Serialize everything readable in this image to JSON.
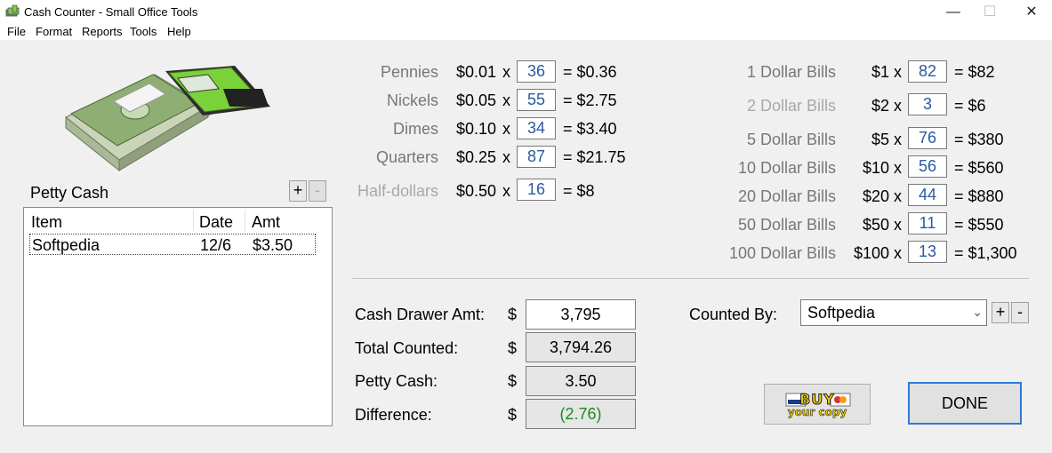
{
  "window": {
    "title": "Cash Counter - Small Office Tools",
    "min": "—",
    "max": "☐",
    "close": "✕"
  },
  "menu": [
    "File",
    "Format",
    "Reports",
    "Tools",
    "Help"
  ],
  "coins": [
    {
      "label": "Pennies",
      "rate": "$0.01",
      "x": "x",
      "qty": "36",
      "total": "= $0.36"
    },
    {
      "label": "Nickels",
      "rate": "$0.05",
      "x": "x",
      "qty": "55",
      "total": "= $2.75"
    },
    {
      "label": "Dimes",
      "rate": "$0.10",
      "x": "x",
      "qty": "34",
      "total": "= $3.40"
    },
    {
      "label": "Quarters",
      "rate": "$0.25",
      "x": "x",
      "qty": "87",
      "total": "= $21.75"
    },
    {
      "label": "Half-dollars",
      "rate": "$0.50",
      "x": "x",
      "qty": "16",
      "total": "= $8"
    }
  ],
  "bills": [
    {
      "label": "1 Dollar Bills",
      "rate": "$1",
      "x": "x",
      "qty": "82",
      "total": "= $82"
    },
    {
      "label": "2 Dollar Bills",
      "rate": "$2",
      "x": "x",
      "qty": "3",
      "total": "= $6"
    },
    {
      "label": "5 Dollar Bills",
      "rate": "$5",
      "x": "x",
      "qty": "76",
      "total": "= $380"
    },
    {
      "label": "10 Dollar Bills",
      "rate": "$10",
      "x": "x",
      "qty": "56",
      "total": "= $560"
    },
    {
      "label": "20 Dollar Bills",
      "rate": "$20",
      "x": "x",
      "qty": "44",
      "total": "= $880"
    },
    {
      "label": "50 Dollar Bills",
      "rate": "$50",
      "x": "x",
      "qty": "11",
      "total": "= $550"
    },
    {
      "label": "100 Dollar Bills",
      "rate": "$100",
      "x": "x",
      "qty": "13",
      "total": "= $1,300"
    }
  ],
  "petty": {
    "title": "Petty Cash",
    "add": "+",
    "remove": "-",
    "columns": [
      "Item",
      "Date",
      "Amt"
    ],
    "rows": [
      {
        "item": "Softpedia",
        "date": "12/6",
        "amt": "$3.50"
      }
    ]
  },
  "summary": {
    "currency": "$",
    "items": [
      {
        "label": "Cash Drawer Amt:",
        "value": "3,795"
      },
      {
        "label": "Total Counted:",
        "value": "3,794.26"
      },
      {
        "label": "Petty Cash:",
        "value": "3.50"
      },
      {
        "label": "Difference:",
        "value": "(2.76)"
      }
    ]
  },
  "counted_by": {
    "label": "Counted By:",
    "value": "Softpedia",
    "add": "+",
    "remove": "-"
  },
  "buttons": {
    "buy_top": "BUY",
    "buy_bottom": "your copy",
    "done": "DONE"
  },
  "colors": {
    "qty_text": "#2a5aa0",
    "difference_text": "#1e8a1e",
    "done_border": "#2c7bd6"
  }
}
